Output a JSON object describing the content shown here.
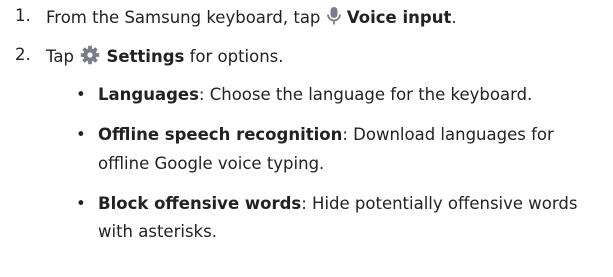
{
  "steps": [
    {
      "number": "1.",
      "before": "From the Samsung keyboard, tap ",
      "icon": "microphone-icon",
      "bold": "Voice input",
      "after": "."
    },
    {
      "number": "2.",
      "before": "Tap ",
      "icon": "gear-icon",
      "bold": "Settings",
      "after": " for options."
    }
  ],
  "options": [
    {
      "bullet": "•",
      "title": "Languages",
      "line1": ": Choose the language for the keyboard.",
      "line2": ""
    },
    {
      "bullet": "•",
      "title": "Offline speech recognition",
      "line1": ": Download languages for",
      "line2": "offline Google voice typing."
    },
    {
      "bullet": "•",
      "title": "Block offensive words",
      "line1": ": Hide potentially offensive words",
      "line2": "with asterisks."
    }
  ],
  "colors": {
    "text": "#222222",
    "icon": "#7a7f87"
  }
}
